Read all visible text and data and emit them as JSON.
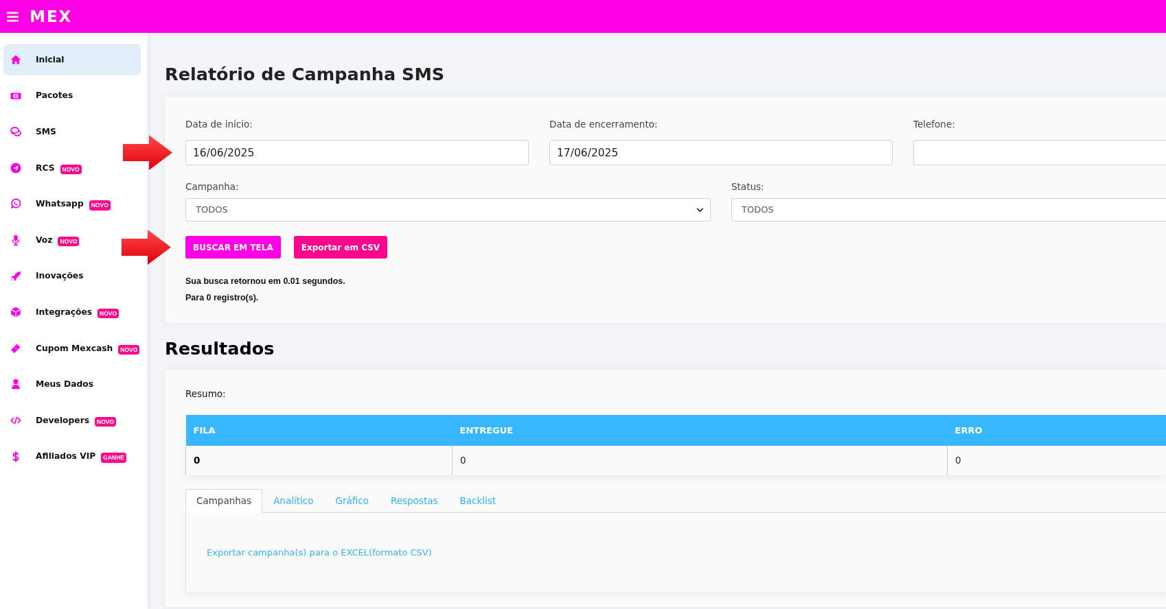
{
  "topbar": {
    "brand": "MEX"
  },
  "sidebar": {
    "items": [
      {
        "label": "Inicial",
        "selected": true
      },
      {
        "label": "Pacotes",
        "selected": false
      },
      {
        "label": "SMS",
        "selected": false
      },
      {
        "label": "RCS",
        "badge": "NOVO",
        "selected": false
      },
      {
        "label": "Whatsapp",
        "badge": "NOVO",
        "selected": false
      },
      {
        "label": "Voz",
        "badge": "NOVO",
        "selected": false
      },
      {
        "label": "Inovações",
        "selected": false
      },
      {
        "label": "Integrações",
        "badge": "NOVO",
        "selected": false
      },
      {
        "label": "Cupom Mexcash",
        "badge": "NOVO",
        "selected": false
      },
      {
        "label": "Meus Dados",
        "selected": false
      },
      {
        "label": "Developers",
        "badge": "NOVO",
        "selected": false
      },
      {
        "label": "Afiliados VIP",
        "badge": "GANHE",
        "selected": false
      }
    ]
  },
  "page_title": "Relatório de Campanha SMS",
  "filters": {
    "fields": [
      {
        "label": "Data de início:",
        "value": "16/06/2025",
        "highlight_arrow": true
      },
      {
        "label": "Data de encerramento:",
        "value": "17/06/2025",
        "highlight_arrow": false
      },
      {
        "label": "Telefone:",
        "highlight_arrow": false
      }
    ],
    "selects": [
      {
        "label": "Campanha:",
        "value": "TODOS"
      },
      {
        "label": "Status:",
        "value": "TODOS"
      }
    ],
    "buttons": [
      {
        "label": "BUSCAR EM TELA",
        "kind": "primary",
        "highlight_arrow": true
      },
      {
        "label": "Exportar em CSV",
        "kind": "secondary",
        "highlight_arrow": false
      }
    ],
    "result_info": [
      "Sua busca retornou em 0.01 segundos.",
      "Para 0 registro(s)."
    ]
  },
  "results": {
    "title": "Resultados",
    "summary_label": "Resumo:",
    "table": {
      "columns": [
        "FILA",
        "ENTREGUE",
        "ERRO"
      ],
      "rows": [
        [
          "0",
          "0",
          "0"
        ]
      ]
    },
    "tabs": [
      {
        "label": "Campanhas",
        "selected": true
      },
      {
        "label": "Analítico",
        "selected": false
      },
      {
        "label": "Gráfico",
        "selected": false
      },
      {
        "label": "Respostas",
        "selected": false
      },
      {
        "label": "Backlist",
        "selected": false
      }
    ],
    "export_link": "Exportar campanha(s) para o EXCEL(formato CSV)"
  }
}
